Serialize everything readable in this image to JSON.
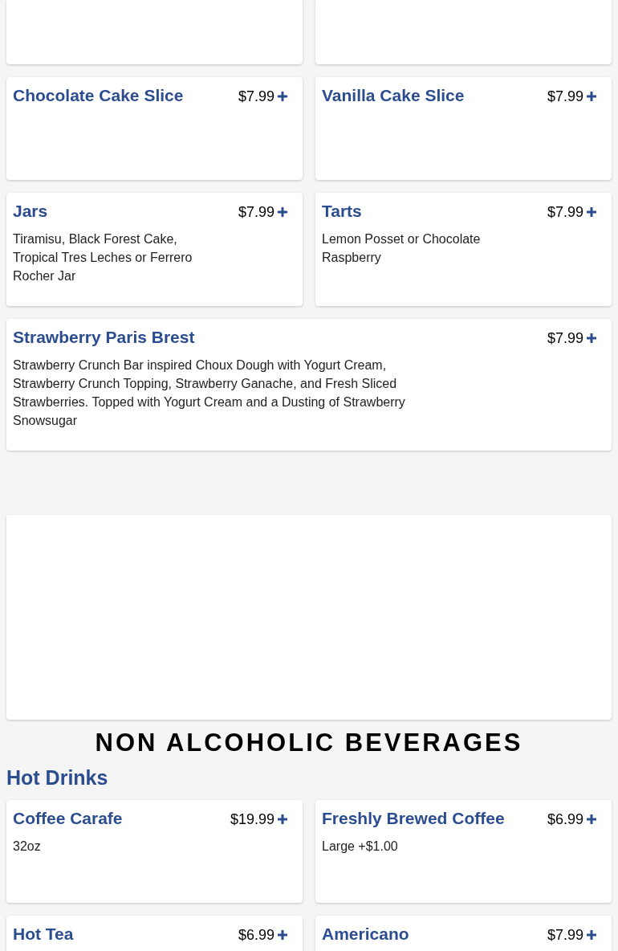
{
  "dessert_items": [
    {
      "title": "Chocolate Cake Slice",
      "price": "$7.99",
      "kind": "half"
    },
    {
      "title": "Vanilla Cake Slice",
      "price": "$7.99",
      "kind": "half"
    },
    {
      "title": "Jars",
      "description": "Tiramisu, Black Forest Cake, Tropical Tres Leches or Ferrero Rocher Jar",
      "price": "$7.99",
      "kind": "half"
    },
    {
      "title": "Tarts",
      "description": "Lemon Posset or Chocolate Raspberry",
      "price": "$7.99",
      "kind": "half"
    },
    {
      "title": "Strawberry Paris Brest",
      "description": "Strawberry Crunch Bar inspired Choux Dough with Yogurt Cream, Strawberry Crunch Topping, Strawberry Ganache, and Fresh Sliced Strawberries. Topped with Yogurt Cream and a Dusting of Strawberry Snowsugar",
      "price": "$7.99",
      "kind": "wide"
    }
  ],
  "section_heading": "NON ALCOHOLIC BEVERAGES",
  "category": "Hot Drinks",
  "beverage_items": [
    {
      "title": "Coffee Carafe",
      "description": "32oz",
      "price": "$19.99",
      "kind": "half"
    },
    {
      "title": "Freshly Brewed Coffee",
      "description": "Large +$1.00",
      "price": "$6.99",
      "kind": "half"
    },
    {
      "title": "Hot Tea",
      "price": "$6.99",
      "kind": "half"
    },
    {
      "title": "Americano",
      "price": "$7.99",
      "kind": "half"
    }
  ]
}
